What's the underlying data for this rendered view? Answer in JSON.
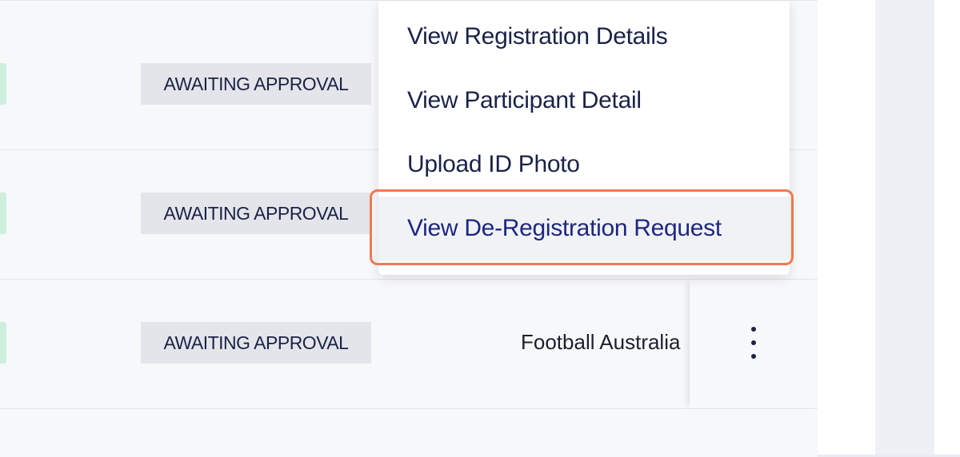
{
  "rows": [
    {
      "status": "AWAITING APPROVAL",
      "organisation": ""
    },
    {
      "status": "AWAITING APPROVAL",
      "organisation": ""
    },
    {
      "status": "AWAITING APPROVAL",
      "organisation": "Football Australia"
    }
  ],
  "menu": {
    "items": [
      "View Registration Details",
      "View Participant Detail",
      "Upload ID Photo",
      "View De-Registration Request"
    ],
    "highlighted_item": "View De-Registration Request"
  },
  "colors": {
    "highlight_border": "#ef7a4f",
    "badge_background": "#e4e5ea",
    "menu_text": "#1b2247",
    "row_accent": "#cfeedd"
  },
  "icons": {
    "row_actions": "kebab-menu-icon"
  }
}
